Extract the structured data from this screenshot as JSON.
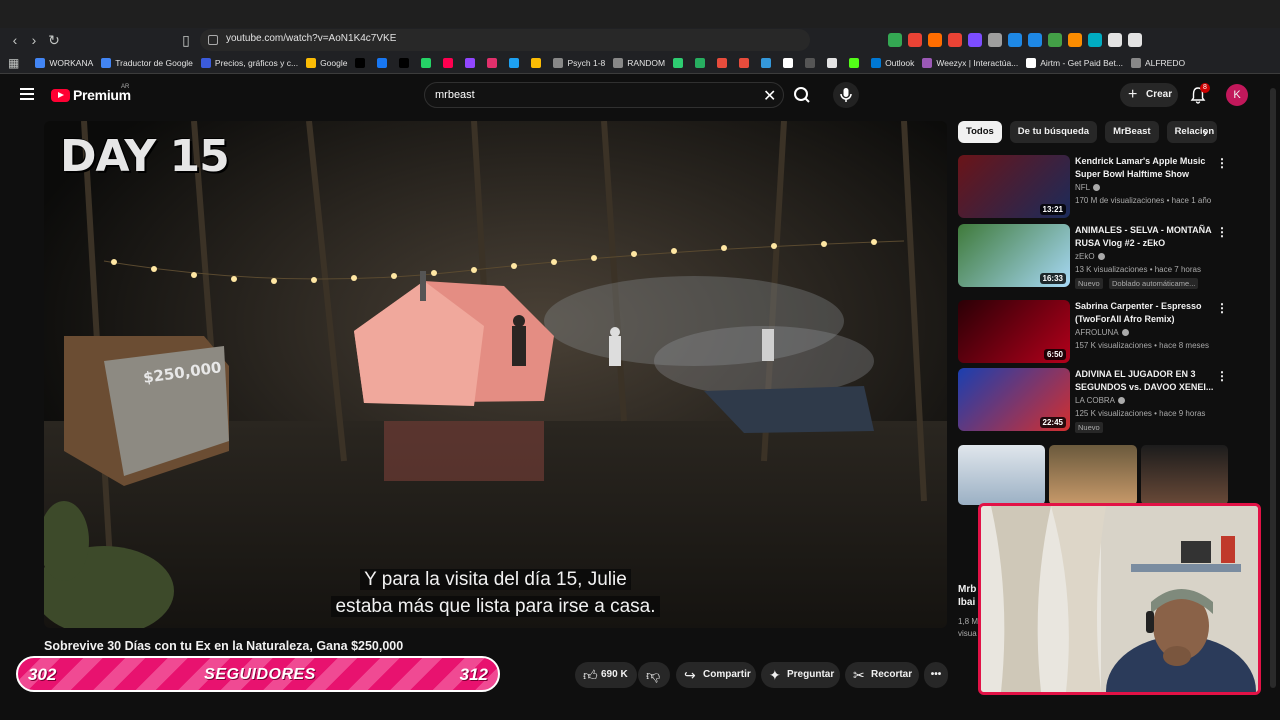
{
  "browser": {
    "url": "youtube.com/watch?v=AoN1K4c7VKE",
    "bookmarks": [
      {
        "label": "WORKANA",
        "color": "#4285f4"
      },
      {
        "label": "Traductor de Google",
        "color": "#4285f4"
      },
      {
        "label": "Precios, gráficos y c...",
        "color": "#3b5bdb"
      },
      {
        "label": "Google",
        "color": "#fbbc05"
      },
      {
        "label": "",
        "color": "#000000"
      },
      {
        "label": "",
        "color": "#1877f2"
      },
      {
        "label": "",
        "color": "#000000"
      },
      {
        "label": "",
        "color": "#25d366"
      },
      {
        "label": "",
        "color": "#ff0050"
      },
      {
        "label": "",
        "color": "#9146ff"
      },
      {
        "label": "",
        "color": "#e1306c"
      },
      {
        "label": "",
        "color": "#1da1f2"
      },
      {
        "label": "",
        "color": "#fbbc05"
      },
      {
        "label": "Psych 1-8",
        "color": "#888888"
      },
      {
        "label": "RANDOM",
        "color": "#888888"
      },
      {
        "label": "",
        "color": "#2ecc71"
      },
      {
        "label": "",
        "color": "#27ae60"
      },
      {
        "label": "",
        "color": "#e74c3c"
      },
      {
        "label": "",
        "color": "#e74c3c"
      },
      {
        "label": "",
        "color": "#3498db"
      },
      {
        "label": "",
        "color": "#ffffff"
      },
      {
        "label": "",
        "color": "#555555"
      },
      {
        "label": "",
        "color": "#e3e3e3"
      },
      {
        "label": "",
        "color": "#53fc18"
      },
      {
        "label": "Outlook",
        "color": "#0078d4"
      },
      {
        "label": "Weezyx | Interactúa...",
        "color": "#9b59b6"
      },
      {
        "label": "Airtm - Get Paid Bet...",
        "color": "#ffffff"
      },
      {
        "label": "ALFREDO",
        "color": "#888888"
      }
    ],
    "extension_colors": [
      "#34a853",
      "#ea4335",
      "#ff6d00",
      "#ea4335",
      "#7c4dff",
      "#9e9e9e",
      "#1e88e5",
      "#1e88e5",
      "#43a047",
      "#fb8c00",
      "#00acc1",
      "#e3e3e3",
      "#e3e3e3"
    ]
  },
  "youtube": {
    "logo_text": "Premium",
    "country_code": "AR",
    "search_value": "mrbeast",
    "create_label": "Crear",
    "notification_count": "8",
    "avatar_letter": "K"
  },
  "player": {
    "overlay_text": "DAY 15",
    "subtitle_line1": "Y para la visita del día 15, Julie",
    "subtitle_line2": "estaba más que lista para irse a casa.",
    "video_title": "Sobrevive 30 Días con tu Ex en la Naturaleza, Gana $250,000"
  },
  "actions": {
    "likes": "690 K",
    "share": "Compartir",
    "ask": "Preguntar",
    "clip": "Recortar"
  },
  "followers": {
    "current": "302",
    "label": "SEGUIDORES",
    "goal": "312"
  },
  "chips": [
    "Todos",
    "De tu búsqueda",
    "MrBeast",
    "Relacion"
  ],
  "recommendations": [
    {
      "title": "Kendrick Lamar's Apple Music Super Bowl Halftime Show",
      "channel": "NFL",
      "meta": "170 M de visualizaciones • hace 1 año",
      "duration": "13:21",
      "thumb_colors": [
        "#6a1418",
        "#1b2b5a"
      ]
    },
    {
      "title": "ANIMALES - SELVA - MONTAÑA RUSA Vlog #2 - zEkO",
      "channel": "zEkO",
      "meta": "13 K visualizaciones • hace 7 horas",
      "duration": "16:33",
      "badge": "Nuevo",
      "badge2": "Doblado automáticame...",
      "thumb_colors": [
        "#3f7a3a",
        "#a7d8f5"
      ]
    },
    {
      "title": "Sabrina Carpenter - Espresso (TwoForAll Afro Remix)",
      "channel": "AFROLUNA",
      "meta": "157 K visualizaciones • hace 8 meses",
      "duration": "6:50",
      "thumb_colors": [
        "#2a0006",
        "#b3001b"
      ]
    },
    {
      "title": "ADIVINA EL JUGADOR EN 3 SEGUNDOS vs. DAVOO XENEI...",
      "channel": "LA COBRA",
      "meta": "125 K visualizaciones • hace 9 horas",
      "duration": "22:45",
      "badge": "Nuevo",
      "thumb_colors": [
        "#1a3fb0",
        "#d32f2f"
      ]
    }
  ],
  "partial_sidebar": {
    "title_line1": "Mrb",
    "title_line2": "Ibai",
    "meta_line1": "1,8 M",
    "meta_line2": "visua"
  }
}
